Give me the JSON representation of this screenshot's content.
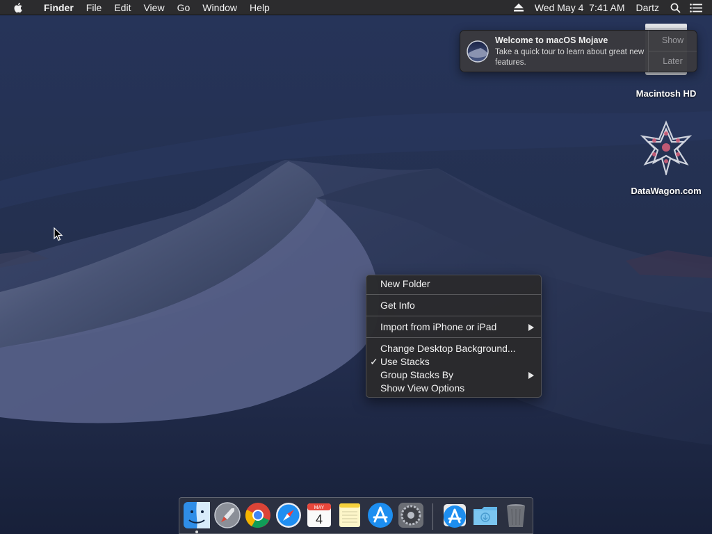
{
  "menubar": {
    "app_name": "Finder",
    "menus": [
      "File",
      "Edit",
      "View",
      "Go",
      "Window",
      "Help"
    ],
    "clock": "Wed May 4  7:41 AM",
    "user": "Dartz"
  },
  "desktop": {
    "icons": [
      {
        "label": "Macintosh HD"
      },
      {
        "label": "DataWagon.com"
      }
    ]
  },
  "notification": {
    "title": "Welcome to macOS Mojave",
    "body": "Take a quick tour to learn about great new features.",
    "show_label": "Show",
    "later_label": "Later"
  },
  "context_menu": {
    "items": [
      {
        "label": "New Folder"
      },
      {
        "label": "Get Info"
      },
      {
        "label": "Import from iPhone or iPad",
        "submenu": true
      },
      {
        "label": "Change Desktop Background..."
      },
      {
        "label": "Use Stacks",
        "checked": true
      },
      {
        "label": "Group Stacks By",
        "submenu": true
      },
      {
        "label": "Show View Options"
      }
    ]
  },
  "dock": {
    "apps": [
      "finder-icon",
      "launchpad-icon",
      "chrome-icon",
      "safari-icon",
      "calendar-icon",
      "notes-icon",
      "app-store-icon",
      "system-preferences-icon",
      "app-store-downloads-icon",
      "downloads-folder-icon",
      "trash-icon"
    ],
    "calendar_month": "MAY",
    "calendar_day": "4"
  },
  "colors": {
    "menubar_bg": "#2c2c2e",
    "menu_bg": "#2a2a2c",
    "wallpaper_sky": "#1f2c4a",
    "wallpaper_dune": "#3d4a6a"
  }
}
